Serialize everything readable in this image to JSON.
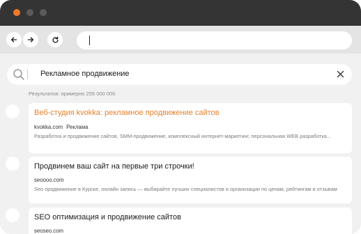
{
  "colors": {
    "accent": "#e8802a",
    "dot_orange": "#f07a2a",
    "dot_gray": "#5a5a5a"
  },
  "window_controls": [
    "close",
    "minimize",
    "maximize"
  ],
  "toolbar": {
    "back_icon": "arrow-left-icon",
    "forward_icon": "arrow-right-icon",
    "reload_icon": "reload-icon",
    "address_value": ""
  },
  "search": {
    "icon": "search-icon",
    "query": "Рекламное продвижение",
    "clear_icon": "close-icon"
  },
  "stats": "Результатов: примерно 255 000 000",
  "results": [
    {
      "title": "Веб-студия kvokka: рекламное продвижение сайтов",
      "url": "kvokka.com",
      "badge": "Реклама",
      "description": "Разработка и продвижение сайтов, SMM-продвижение, комплексный интернет-маркетинг, персональная WEB разработка..."
    },
    {
      "title": "Продвинем ваш сайт на первые три строчки!",
      "url": "seoooo.com",
      "badge": "",
      "description": "Seo продвижение в Курске, онлайн запись — выбирайте лучших специалистов и организации по ценам, рейтингам и отзывам"
    },
    {
      "title": "SEO оптимизация и продвижение сайтов",
      "url": "seoseo.com",
      "badge": "",
      "description": ""
    }
  ]
}
